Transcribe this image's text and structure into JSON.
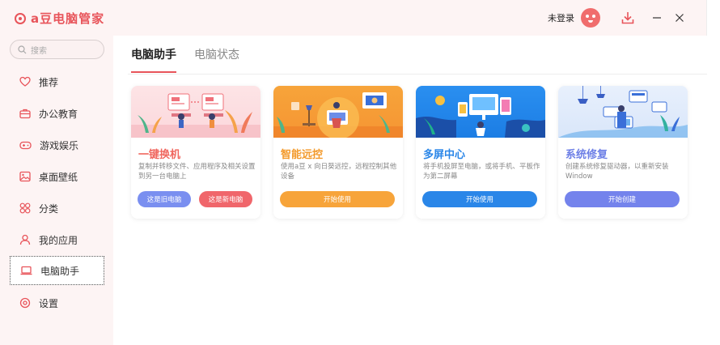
{
  "app": {
    "title": "a豆电脑管家",
    "login": "未登录"
  },
  "search": {
    "placeholder": "搜索"
  },
  "sidebar": {
    "items": [
      {
        "label": "推荐",
        "icon": "heart-icon"
      },
      {
        "label": "办公教育",
        "icon": "briefcase-icon"
      },
      {
        "label": "游戏娱乐",
        "icon": "gamepad-icon"
      },
      {
        "label": "桌面壁纸",
        "icon": "image-icon"
      },
      {
        "label": "分类",
        "icon": "grid-icon"
      },
      {
        "label": "我的应用",
        "icon": "user-icon"
      },
      {
        "label": "电脑助手",
        "icon": "laptop-icon",
        "active": true
      },
      {
        "label": "设置",
        "icon": "settings-icon"
      }
    ]
  },
  "tabs": [
    {
      "label": "电脑助手",
      "active": true
    },
    {
      "label": "电脑状态",
      "active": false
    }
  ],
  "cards": [
    {
      "title": "一键换机",
      "title_color": "#f0665e",
      "desc": "复制并转移文件、应用程序及相关设置到另一台电脑上",
      "buttons": [
        {
          "label": "这是旧电脑",
          "color": "#7a8ff0"
        },
        {
          "label": "这是新电脑",
          "color": "#f0666b"
        }
      ]
    },
    {
      "title": "智能远控",
      "title_color": "#f39a2b",
      "desc": "使用a豆 x 向日葵远控，远程控制其他设备",
      "buttons": [
        {
          "label": "开始使用",
          "color": "#f7a43a"
        }
      ]
    },
    {
      "title": "多屏中心",
      "title_color": "#2a86e8",
      "desc": "将手机投屏至电脑，或将手机、平板作为第二屏幕",
      "buttons": [
        {
          "label": "开始使用",
          "color": "#2a86e8"
        }
      ]
    },
    {
      "title": "系统修复",
      "title_color": "#6d7fe6",
      "desc": "创建系统修复驱动器，以重新安装Window",
      "buttons": [
        {
          "label": "开始创建",
          "color": "#7483ec"
        }
      ]
    }
  ]
}
